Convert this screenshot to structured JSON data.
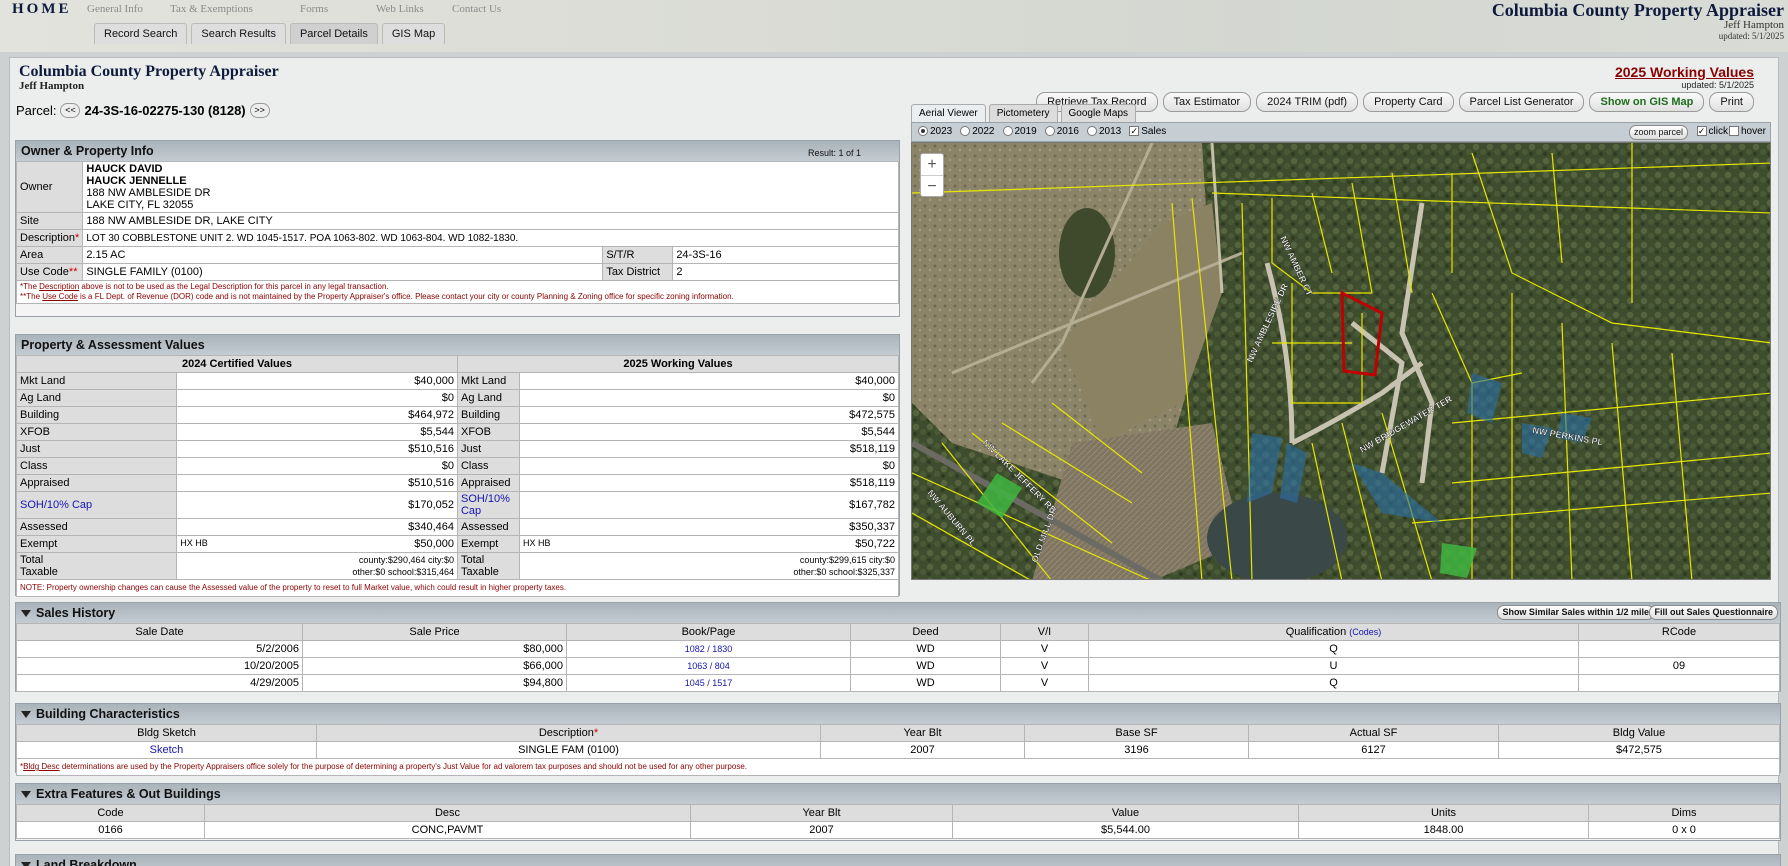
{
  "topnav": {
    "home": "HOME",
    "links": [
      "General Info",
      "Tax & Exemptions",
      "Forms",
      "Web Links",
      "Contact Us"
    ]
  },
  "tabs": [
    "Record Search",
    "Search Results",
    "Parcel Details",
    "GIS Map"
  ],
  "brand": {
    "title": "Columbia County Property Appraiser",
    "name": "Jeff Hampton",
    "updated": "updated: 5/1/2025"
  },
  "header": {
    "title": "Columbia County Property Appraiser",
    "name": "Jeff Hampton",
    "working_values": "2025 Working Values",
    "wv_updated": "updated: 5/1/2025"
  },
  "buttons": [
    "Retrieve Tax Record",
    "Tax Estimator",
    "2024 TRIM (pdf)",
    "Property Card",
    "Parcel List Generator",
    "Show on GIS Map",
    "Print"
  ],
  "parcel": {
    "label": "Parcel:",
    "prev": "<<",
    "next": ">>",
    "id": "24-3S-16-02275-130 (8128)"
  },
  "owner_panel": {
    "title": "Owner & Property Info",
    "result": "Result: 1 of 1",
    "owner_label": "Owner",
    "owner_lines": [
      "HAUCK DAVID",
      "HAUCK JENNELLE",
      "188 NW AMBLESIDE DR",
      "LAKE CITY, FL 32055"
    ],
    "site_label": "Site",
    "site": "188 NW AMBLESIDE DR, LAKE CITY",
    "desc_label": "Description",
    "desc": "LOT 30 COBBLESTONE UNIT 2. WD 1045-1517. POA 1063-802. WD 1063-804. WD 1082-1830.",
    "area_label": "Area",
    "area": "2.15 AC",
    "str_label": "S/T/R",
    "str": "24-3S-16",
    "use_label": "Use Code",
    "use": "SINGLE FAMILY (0100)",
    "tax_label": "Tax District",
    "tax": "2",
    "note1a": "*The ",
    "note1b": "Description",
    "note1c": " above is not to be used as the Legal Description for this parcel in any legal transaction.",
    "note2a": "**The ",
    "note2b": "Use Code",
    "note2c": " is a FL Dept. of Revenue (DOR) code and is not maintained by the Property Appraiser's office. Please contact your city or county Planning & Zoning office for specific zoning information."
  },
  "values_panel": {
    "title": "Property & Assessment Values",
    "col1": "2024 Certified Values",
    "col2": "2025 Working Values",
    "rows": [
      {
        "label": "Mkt Land",
        "v1": "$40,000",
        "v2": "$40,000"
      },
      {
        "label": "Ag Land",
        "v1": "$0",
        "v2": "$0"
      },
      {
        "label": "Building",
        "v1": "$464,972",
        "v2": "$472,575"
      },
      {
        "label": "XFOB",
        "v1": "$5,544",
        "v2": "$5,544"
      },
      {
        "label": "Just",
        "v1": "$510,516",
        "v2": "$518,119"
      },
      {
        "label": "Class",
        "v1": "$0",
        "v2": "$0"
      },
      {
        "label": "Appraised",
        "v1": "$510,516",
        "v2": "$518,119"
      },
      {
        "label": "SOH/10% Cap",
        "v1": "$170,052",
        "v2": "$167,782"
      },
      {
        "label": "Assessed",
        "v1": "$340,464",
        "v2": "$350,337"
      }
    ],
    "exempt_label": "Exempt",
    "exempt1_code": "HX HB",
    "exempt1": "$50,000",
    "exempt2_code": "HX HB",
    "exempt2": "$50,722",
    "taxable_label1": "Total",
    "taxable_label2": "Taxable",
    "t1_line1": "county:$290,464 city:$0",
    "t1_line2": "other:$0 school:$315,464",
    "t2_line1": "county:$299,615 city:$0",
    "t2_line2": "other:$0 school:$325,337",
    "note": "NOTE: Property ownership changes can cause the Assessed value of the property to reset to full Market value, which could result in higher property taxes."
  },
  "viewer": {
    "tabs": [
      "Aerial Viewer",
      "Pictometery",
      "Google Maps"
    ],
    "years": [
      "2023",
      "2022",
      "2019",
      "2016",
      "2013"
    ],
    "sales": "Sales",
    "zoom_parcel": "zoom parcel",
    "click": "click",
    "hover": "hover",
    "zoom_in": "+",
    "zoom_out": "−",
    "streets": [
      "NW AMBER CT",
      "NW AMBLESIDE DR",
      "NW BRIDGEWATER TER",
      "NW PERKINS PL",
      "NW LAKE JEFFERY RD",
      "NW AUBURN PL",
      "OLD MILL DR"
    ]
  },
  "sales": {
    "title": "Sales History",
    "btn1": "Show Similar Sales within 1/2 mile",
    "btn2": "Fill out Sales Questionnaire",
    "headers": [
      "Sale Date",
      "Sale Price",
      "Book/Page",
      "Deed",
      "V/I",
      "Qualification",
      "RCode"
    ],
    "codes": "(Codes)",
    "rows": [
      [
        "5/2/2006",
        "$80,000",
        "1082 / 1830",
        "WD",
        "V",
        "Q",
        ""
      ],
      [
        "10/20/2005",
        "$66,000",
        "1063 / 804",
        "WD",
        "V",
        "U",
        "09"
      ],
      [
        "4/29/2005",
        "$94,800",
        "1045 / 1517",
        "WD",
        "V",
        "Q",
        ""
      ]
    ]
  },
  "building": {
    "title": "Building Characteristics",
    "headers": [
      "Bldg Sketch",
      "Description",
      "Year Blt",
      "Base SF",
      "Actual SF",
      "Bldg Value"
    ],
    "rows": [
      [
        "Sketch",
        "SINGLE FAM (0100)",
        "2007",
        "3196",
        "6127",
        "$472,575"
      ]
    ],
    "note_a": "*",
    "note_b": "Bldg Desc",
    "note_c": " determinations are used by the Property Appraisers office solely for the purpose of determining a property's Just Value for ad valorem tax purposes and should not be used for any other purpose."
  },
  "extra": {
    "title": "Extra Features & Out Buildings",
    "headers": [
      "Code",
      "Desc",
      "Year Blt",
      "Value",
      "Units",
      "Dims"
    ],
    "rows": [
      [
        "0166",
        "CONC,PAVMT",
        "2007",
        "$5,544.00",
        "1848.00",
        "0 x 0"
      ]
    ]
  },
  "land": {
    "title": "Land Breakdown"
  },
  "colors": {
    "accent": "#0d1a3c",
    "working_values": "#8b0000",
    "gis_green": "#1d6d1d",
    "parcel_outline": "#c00000",
    "parcel_lines": "#e6e600"
  }
}
